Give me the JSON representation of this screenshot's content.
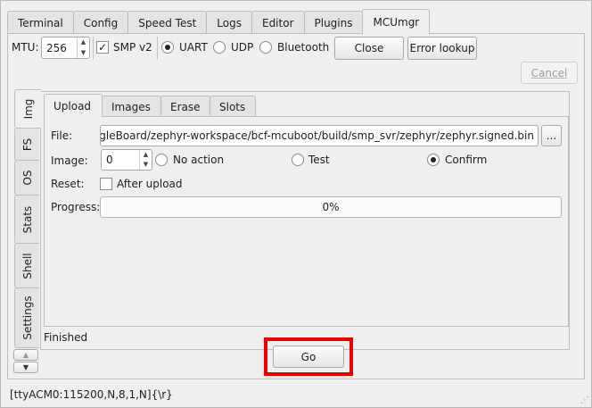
{
  "top_tabs": [
    "Terminal",
    "Config",
    "Speed Test",
    "Logs",
    "Editor",
    "Plugins",
    "MCUmgr"
  ],
  "active_top_tab": "MCUmgr",
  "toolbar": {
    "mtu_label": "MTU:",
    "mtu_value": "256",
    "smp_label": "SMP v2",
    "smp_checked": true,
    "transport_options": [
      "UART",
      "UDP",
      "Bluetooth"
    ],
    "transport_selected": "UART",
    "close_label": "Close",
    "error_lookup_label": "Error lookup",
    "cancel_label": "Cancel"
  },
  "side_tabs": [
    "Img",
    "FS",
    "OS",
    "Stats",
    "Shell",
    "Settings"
  ],
  "active_side_tab": "Img",
  "inner_tabs": [
    "Upload",
    "Images",
    "Erase",
    "Slots"
  ],
  "active_inner_tab": "Upload",
  "upload": {
    "file_label": "File:",
    "file_value": "/BeagleBoard/zephyr-workspace/bcf-mcuboot/build/smp_svr/zephyr/zephyr.signed.bin",
    "browse_label": "...",
    "image_label": "Image:",
    "image_value": "0",
    "action_options": [
      "No action",
      "Test",
      "Confirm"
    ],
    "action_selected": "Confirm",
    "reset_label": "Reset:",
    "after_upload_label": "After upload",
    "after_upload_checked": false,
    "progress_label": "Progress:",
    "progress_text": "0%",
    "progress_value": 0
  },
  "status_text": "Finished",
  "go_label": "Go",
  "statusbar_text": "[ttyACM0:115200,N,8,1,N]{\\r}",
  "colors": {
    "highlight": "#e60000"
  }
}
